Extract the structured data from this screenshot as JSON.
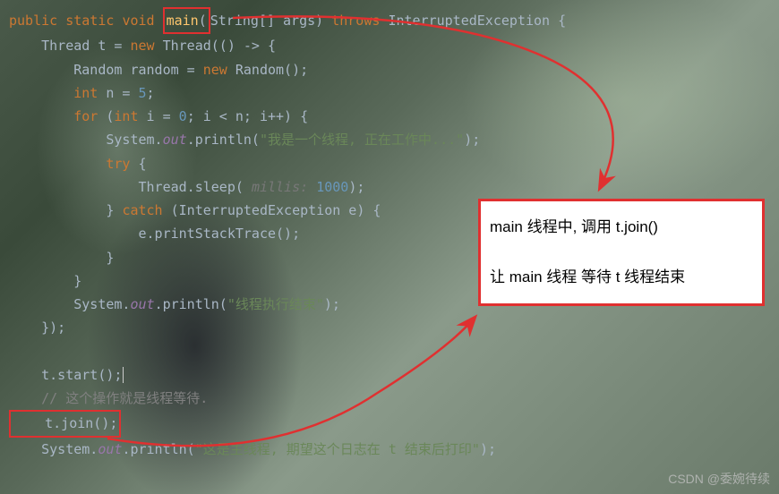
{
  "code": {
    "l1_public": "public ",
    "l1_static": "static ",
    "l1_void": "void ",
    "l1_main": "main",
    "l1_paren_open": "(",
    "l1_string_arr": "String[] args",
    "l1_close": ") ",
    "l1_throws": "throws ",
    "l1_exc": "InterruptedException {",
    "l2_thread": "    Thread t = ",
    "l2_new": "new ",
    "l2_thread2": "Thread(() -> {",
    "l3_random": "        Random random = ",
    "l3_new": "new ",
    "l3_random2": "Random();",
    "l4_int": "        int ",
    "l4_n": "n = ",
    "l4_5": "5",
    "l4_semi": ";",
    "l5_for": "        for ",
    "l5_open": "(",
    "l5_int": "int ",
    "l5_body": "i = ",
    "l5_0": "0",
    "l5_cond": "; i < n; i++) {",
    "l6_sys": "            System.",
    "l6_out": "out",
    "l6_println": ".println(",
    "l6_str": "\"我是一个线程, 正在工作中...\"",
    "l6_end": ");",
    "l7_try": "            try ",
    "l7_brace": "{",
    "l8_sleep": "                Thread.sleep( ",
    "l8_hint": "millis: ",
    "l8_1000": "1000",
    "l8_end": ");",
    "l9_catch": "            } ",
    "l9_catch_kw": "catch ",
    "l9_body": "(InterruptedException e) {",
    "l10": "                e.printStackTrace();",
    "l11": "            }",
    "l12": "        }",
    "l13_sys": "        System.",
    "l13_out": "out",
    "l13_println": ".println(",
    "l13_str": "\"线程执行结束\"",
    "l13_end": ");",
    "l14": "    });",
    "l15": " ",
    "l16": "    t.start();",
    "l17": "    // 这个操作就是线程等待.",
    "l18": "    t.join();",
    "l19_sys": "    System.",
    "l19_out": "out",
    "l19_println": ".println(",
    "l19_str": "\"这是主线程, 期望这个日志在 t 结束后打印\"",
    "l19_end": ");"
  },
  "annotation": {
    "line1": "main 线程中, 调用  t.join()",
    "line2": "让 main 线程 等待 t 线程结束"
  },
  "watermark": "CSDN @委婉待续"
}
